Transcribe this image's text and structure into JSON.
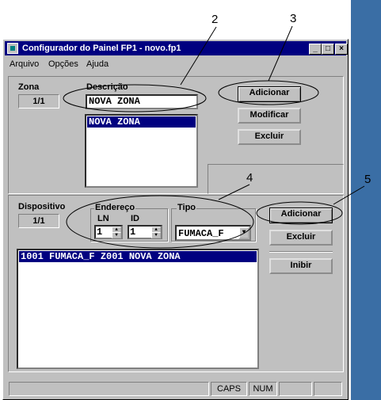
{
  "window": {
    "title": "Configurador do Painel FP1 - novo.fp1"
  },
  "menu": [
    "Arquivo",
    "Opções",
    "Ajuda"
  ],
  "title_buttons": {
    "minimize": "_",
    "maximize": "□",
    "close": "×"
  },
  "zona": {
    "label": "Zona",
    "counter": "1/1",
    "descricao_label": "Descrição",
    "descricao_value": "NOVA ZONA",
    "list_items": [
      "NOVA ZONA"
    ],
    "buttons": {
      "add": "Adicionar",
      "modify": "Modificar",
      "delete": "Excluir"
    }
  },
  "dispositivo": {
    "label": "Dispositivo",
    "counter": "1/1",
    "endereco_label": "Endereço",
    "ln_label": "LN",
    "ln_value": "1",
    "id_label": "ID",
    "id_value": "1",
    "tipo_label": "Tipo",
    "tipo_value": "FUMACA_F",
    "list_items": [
      "1001 FUMACA_F Z001 NOVA ZONA"
    ],
    "buttons": {
      "add": "Adicionar",
      "delete": "Excluir",
      "inhibit": "Inibir"
    }
  },
  "statusbar": {
    "caps": "CAPS",
    "num": "NUM"
  },
  "annotations": [
    "2",
    "3",
    "4",
    "5"
  ]
}
